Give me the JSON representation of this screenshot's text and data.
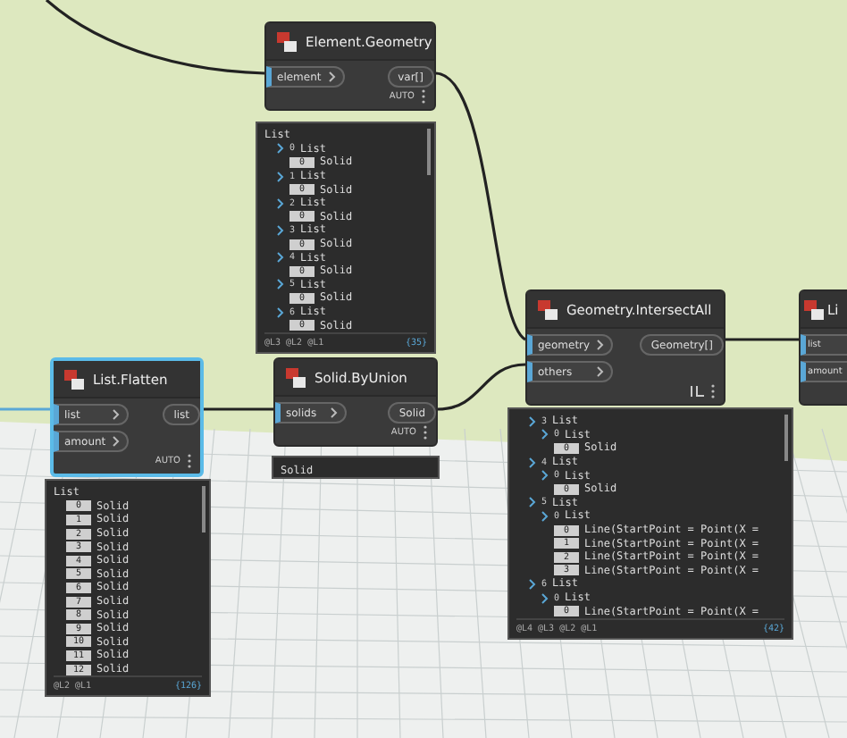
{
  "nodes": [
    {
      "title": "Element.Geometry",
      "selected": false,
      "inputs": [
        {
          "label": "element"
        }
      ],
      "outputs": [
        {
          "label": "var[]"
        }
      ],
      "lacing": "AUTO",
      "preview": {
        "title": "List",
        "items": [
          {
            "index": "0",
            "label": "List",
            "children": [
              {
                "index": "0",
                "label": "Solid"
              }
            ]
          },
          {
            "index": "1",
            "label": "List",
            "children": [
              {
                "index": "0",
                "label": "Solid"
              }
            ]
          },
          {
            "index": "2",
            "label": "List",
            "children": [
              {
                "index": "0",
                "label": "Solid"
              }
            ]
          },
          {
            "index": "3",
            "label": "List",
            "children": [
              {
                "index": "0",
                "label": "Solid"
              }
            ]
          },
          {
            "index": "4",
            "label": "List",
            "children": [
              {
                "index": "0",
                "label": "Solid"
              }
            ]
          },
          {
            "index": "5",
            "label": "List",
            "children": [
              {
                "index": "0",
                "label": "Solid"
              }
            ]
          },
          {
            "index": "6",
            "label": "List",
            "children": [
              {
                "index": "0",
                "label": "Solid"
              }
            ]
          }
        ],
        "levels": "@L3 @L2 @L1",
        "count": "{35}"
      }
    },
    {
      "title": "Geometry.IntersectAll",
      "selected": false,
      "inputs": [
        {
          "label": "geometry"
        },
        {
          "label": "others"
        }
      ],
      "outputs": [
        {
          "label": "Geometry[]"
        }
      ],
      "lacing_icon": true,
      "preview": {
        "items": [
          {
            "index": "3",
            "label": "List",
            "children": [
              {
                "index": "0",
                "label": "List",
                "children": [
                  {
                    "index": "0",
                    "label": "Solid"
                  }
                ]
              }
            ]
          },
          {
            "index": "4",
            "label": "List",
            "children": [
              {
                "index": "0",
                "label": "List",
                "children": [
                  {
                    "index": "0",
                    "label": "Solid"
                  }
                ]
              }
            ]
          },
          {
            "index": "5",
            "label": "List",
            "children": [
              {
                "index": "0",
                "label": "List",
                "children": [
                  {
                    "index": "0",
                    "label": "Line(StartPoint = Point(X ="
                  },
                  {
                    "index": "1",
                    "label": "Line(StartPoint = Point(X ="
                  },
                  {
                    "index": "2",
                    "label": "Line(StartPoint = Point(X ="
                  },
                  {
                    "index": "3",
                    "label": "Line(StartPoint = Point(X ="
                  }
                ]
              }
            ]
          },
          {
            "index": "6",
            "label": "List",
            "children": [
              {
                "index": "0",
                "label": "List",
                "children": [
                  {
                    "index": "0",
                    "label": "Line(StartPoint = Point(X ="
                  }
                ]
              }
            ]
          }
        ],
        "levels": "@L4 @L3 @L2 @L1",
        "count": "{42}"
      }
    },
    {
      "title": "Li",
      "selected": false,
      "inputs": [
        {
          "label": "list"
        },
        {
          "label": "amount"
        }
      ]
    },
    {
      "title": "List.Flatten",
      "selected": true,
      "inputs": [
        {
          "label": "list"
        },
        {
          "label": "amount"
        }
      ],
      "outputs": [
        {
          "label": "list"
        }
      ],
      "lacing": "AUTO",
      "preview": {
        "title": "List",
        "items": [
          {
            "index": "0",
            "label": "Solid"
          },
          {
            "index": "1",
            "label": "Solid"
          },
          {
            "index": "2",
            "label": "Solid"
          },
          {
            "index": "3",
            "label": "Solid"
          },
          {
            "index": "4",
            "label": "Solid"
          },
          {
            "index": "5",
            "label": "Solid"
          },
          {
            "index": "6",
            "label": "Solid"
          },
          {
            "index": "7",
            "label": "Solid"
          },
          {
            "index": "8",
            "label": "Solid"
          },
          {
            "index": "9",
            "label": "Solid"
          },
          {
            "index": "10",
            "label": "Solid"
          },
          {
            "index": "11",
            "label": "Solid"
          },
          {
            "index": "12",
            "label": "Solid"
          }
        ],
        "levels": "@L2 @L1",
        "count": "{126}"
      }
    },
    {
      "title": "Solid.ByUnion",
      "selected": false,
      "inputs": [
        {
          "label": "solids"
        }
      ],
      "outputs": [
        {
          "label": "Solid"
        }
      ],
      "lacing": "AUTO",
      "preview": {
        "title": "Solid"
      }
    }
  ]
}
